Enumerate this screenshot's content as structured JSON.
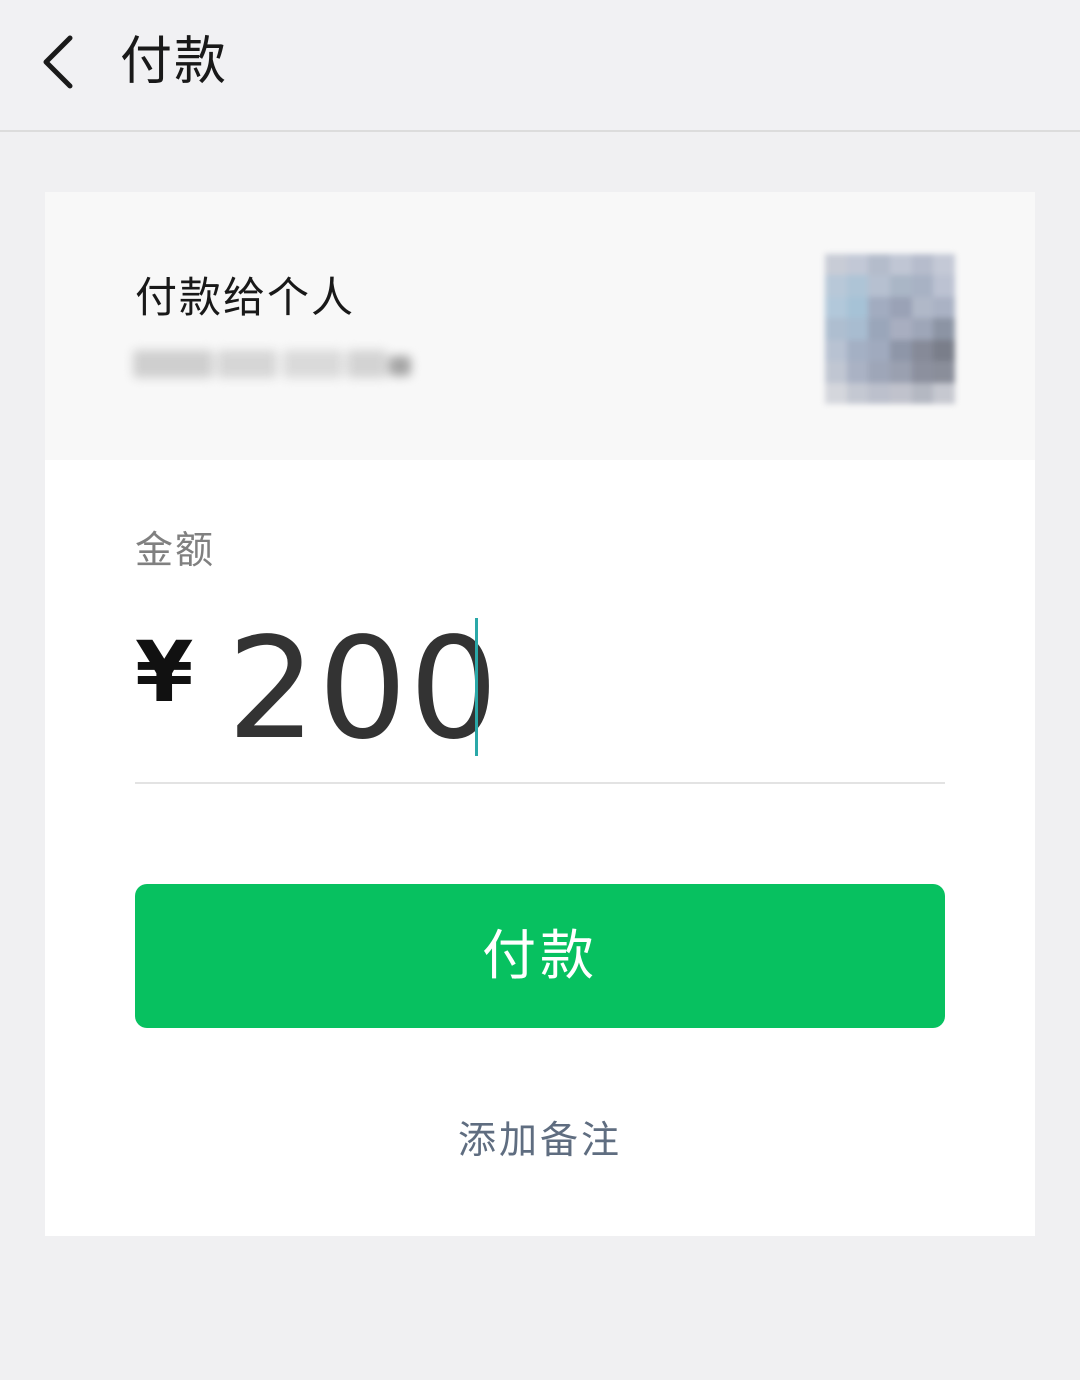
{
  "navbar": {
    "back_icon": "chevron-left-icon",
    "title": "付款"
  },
  "payee": {
    "title": "付款给个人",
    "name_obscured": true
  },
  "amount": {
    "label": "金额",
    "currency_symbol": "¥",
    "value": "200"
  },
  "actions": {
    "pay_label": "付款",
    "add_remark_label": "添加备注"
  },
  "colors": {
    "primary_green": "#07c160",
    "background": "#f0f0f2",
    "card": "#ffffff",
    "remark_link": "#5f6d80",
    "caret": "#2aa8a8"
  }
}
